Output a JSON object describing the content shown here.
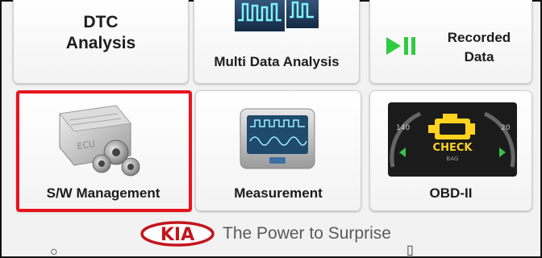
{
  "tiles": {
    "dtc": {
      "line1": "DTC",
      "line2": "Analysis"
    },
    "multi": {
      "label": "Multi Data Analysis"
    },
    "recorded": {
      "line1": "Recorded",
      "line2": "Data"
    },
    "sw": {
      "label": "S/W Management"
    },
    "measurement": {
      "label": "Measurement"
    },
    "obd": {
      "label": "OBD-II"
    }
  },
  "footer": {
    "brand": "KIA",
    "tagline": "The Power to Surprise"
  },
  "art_text": {
    "ecu": "ECU",
    "check": "CHECK",
    "bag": "BAG",
    "gauge_left": "140",
    "gauge_right": "20"
  },
  "icons": {
    "recorded": "play-pause-icon",
    "multi": "waveform-icon",
    "sw": "ecu-gears-icon",
    "measurement": "oscilloscope-icon",
    "obd": "check-engine-icon",
    "footer_left": "circle-icon",
    "footer_right": "book-icon"
  },
  "colors": {
    "highlight": "#e8141c",
    "kia_red": "#c4161c",
    "play_green": "#2ecc40"
  }
}
